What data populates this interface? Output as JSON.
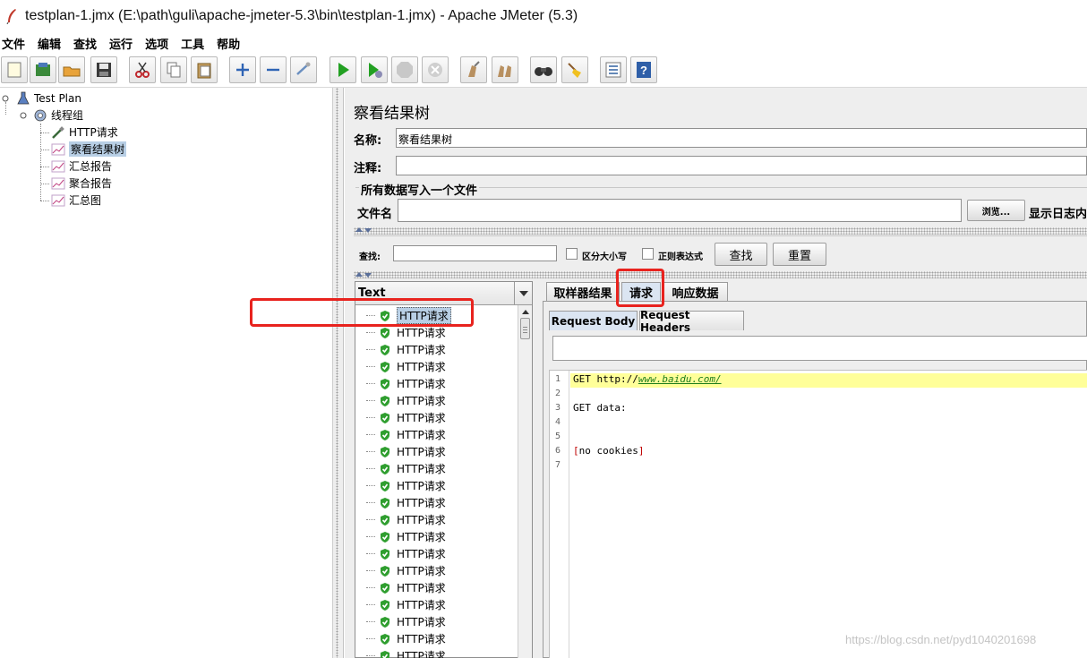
{
  "window": {
    "title": "testplan-1.jmx (E:\\path\\guli\\apache-jmeter-5.3\\bin\\testplan-1.jmx) - Apache JMeter (5.3)"
  },
  "menu": [
    "文件",
    "编辑",
    "查找",
    "运行",
    "选项",
    "工具",
    "帮助"
  ],
  "toolbar": [
    {
      "icon": "new-icon"
    },
    {
      "icon": "templates-icon"
    },
    {
      "icon": "open-icon"
    },
    {
      "icon": "save-icon"
    },
    {
      "icon": "cut-icon"
    },
    {
      "icon": "copy-icon"
    },
    {
      "icon": "paste-icon"
    },
    {
      "icon": "expand-icon"
    },
    {
      "icon": "collapse-icon"
    },
    {
      "icon": "toggle-icon"
    },
    {
      "icon": "start-icon"
    },
    {
      "icon": "start-no-pause-icon"
    },
    {
      "icon": "stop-icon"
    },
    {
      "icon": "shutdown-icon"
    },
    {
      "icon": "clear-icon"
    },
    {
      "icon": "clear-all-icon"
    },
    {
      "icon": "search-icon"
    },
    {
      "icon": "reset-search-icon"
    },
    {
      "icon": "function-helper-icon"
    },
    {
      "icon": "help-icon"
    }
  ],
  "tree": {
    "test_plan": "Test Plan",
    "thread_group": "线程组",
    "children": [
      "HTTP请求",
      "察看结果树",
      "汇总报告",
      "聚合报告",
      "汇总图"
    ],
    "selected": "察看结果树"
  },
  "panel": {
    "title": "察看结果树",
    "name_label": "名称:",
    "name_value": "察看结果树",
    "comment_label": "注释:",
    "comment_value": "",
    "file_group_title": "所有数据写入一个文件",
    "filename_label": "文件名",
    "filename_value": "",
    "browse_label": "浏览...",
    "log_display_label": "显示日志内"
  },
  "search": {
    "label": "查找:",
    "value": "",
    "case_label": "区分大小写",
    "regex_label": "正则表达式",
    "find_button": "查找",
    "reset_button": "重置"
  },
  "results": {
    "renderer": "Text",
    "item_label": "HTTP请求",
    "items": [
      "HTTP请求",
      "HTTP请求",
      "HTTP请求",
      "HTTP请求",
      "HTTP请求",
      "HTTP请求",
      "HTTP请求",
      "HTTP请求",
      "HTTP请求",
      "HTTP请求",
      "HTTP请求",
      "HTTP请求",
      "HTTP请求",
      "HTTP请求",
      "HTTP请求",
      "HTTP请求",
      "HTTP请求",
      "HTTP请求",
      "HTTP请求",
      "HTTP请求",
      "HTTP请求",
      "HTTP请求"
    ],
    "status": "success",
    "status_color": "#2f9e2f"
  },
  "detail": {
    "tabs": [
      "取样器结果",
      "请求",
      "响应数据"
    ],
    "active_tab": "请求",
    "subtabs": [
      "Request Body",
      "Request Headers"
    ],
    "active_subtab": "Request Body",
    "lines": [
      {
        "n": "1",
        "prefix": "GET http://",
        "url": "www.baidu.com/",
        "rest": ""
      },
      {
        "n": "2",
        "prefix": "",
        "url": "",
        "rest": ""
      },
      {
        "n": "3",
        "prefix": "GET data:",
        "url": "",
        "rest": ""
      },
      {
        "n": "4",
        "prefix": "",
        "url": "",
        "rest": ""
      },
      {
        "n": "5",
        "prefix": "",
        "url": "",
        "rest": ""
      },
      {
        "n": "6",
        "prefix": "[",
        "url": "",
        "rest": "no cookies",
        "suffix": "]"
      },
      {
        "n": "7",
        "prefix": "",
        "url": "",
        "rest": ""
      }
    ]
  },
  "watermark": "https://blog.csdn.net/pyd1040201698",
  "colors": {
    "highlight": "#e8231e",
    "selection": "#b8cfe5",
    "code_highlight": "#ffff99"
  }
}
